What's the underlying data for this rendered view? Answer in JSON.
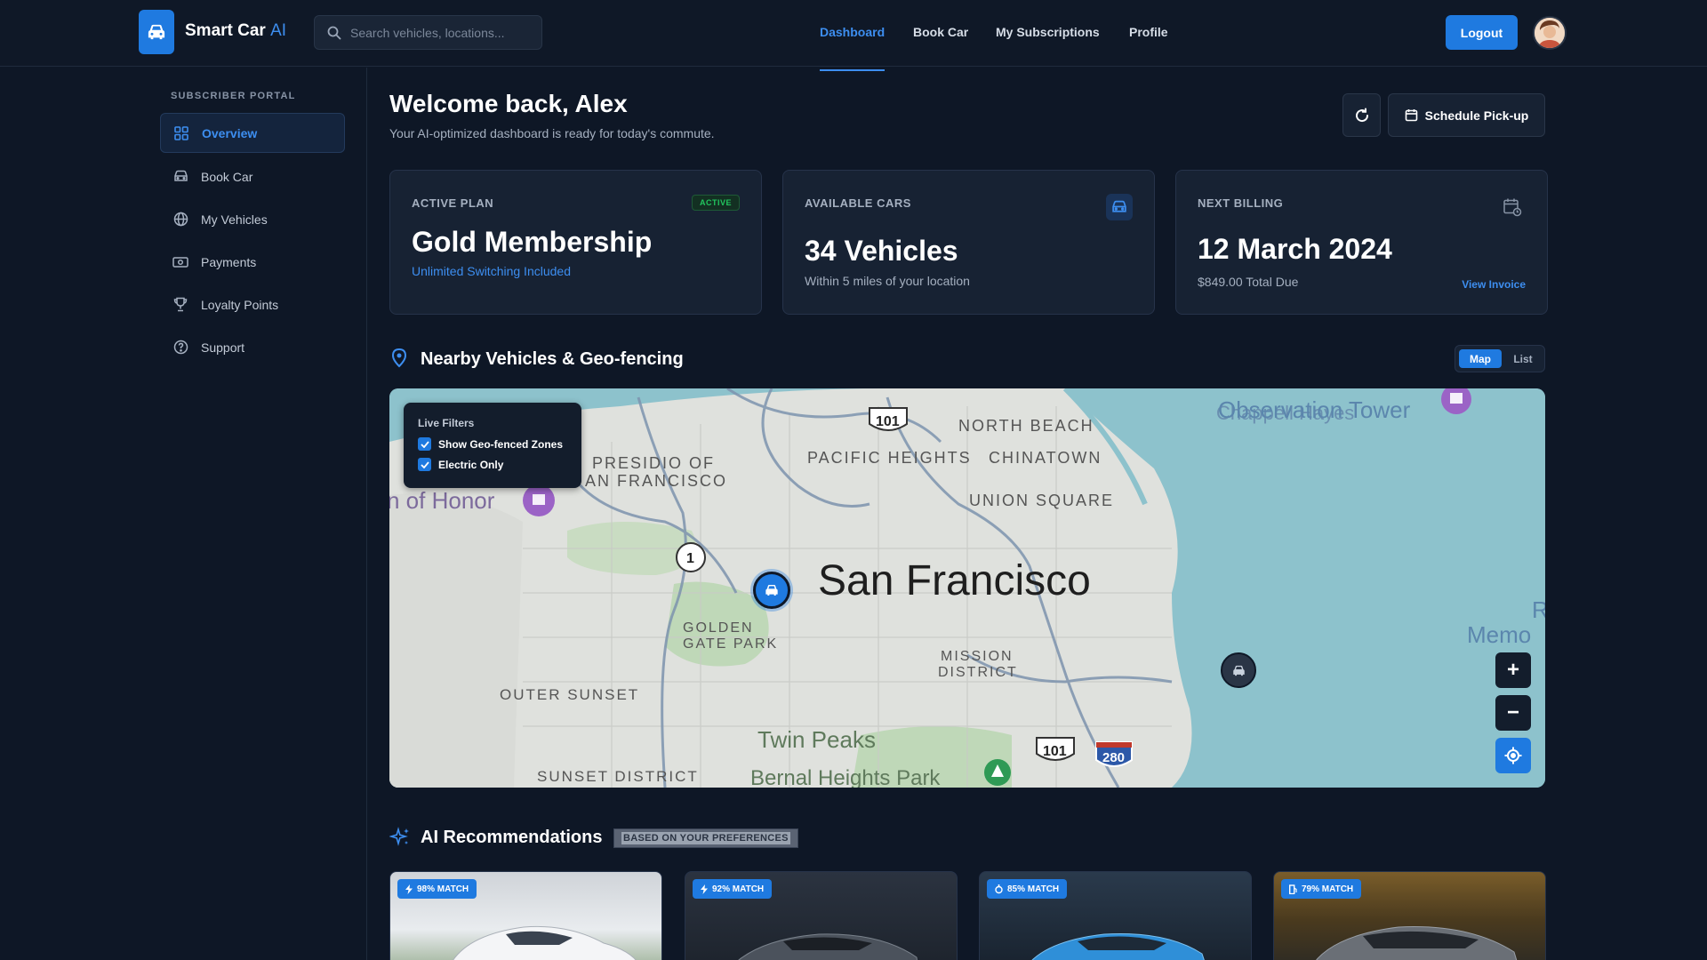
{
  "app": {
    "name": "Smart Car",
    "name_suffix": "AI"
  },
  "search": {
    "placeholder": "Search vehicles, locations..."
  },
  "nav": [
    {
      "label": "Dashboard",
      "active": true
    },
    {
      "label": "Book Car",
      "active": false
    },
    {
      "label": "My Subscriptions",
      "active": false
    },
    {
      "label": "Profile",
      "active": false
    }
  ],
  "header": {
    "logout_label": "Logout"
  },
  "sidebar": {
    "title": "SUBSCRIBER PORTAL",
    "items": [
      {
        "label": "Overview",
        "icon": "grid-icon",
        "active": true
      },
      {
        "label": "Book Car",
        "icon": "car-icon",
        "active": false
      },
      {
        "label": "My Vehicles",
        "icon": "globe-icon",
        "active": false
      },
      {
        "label": "Payments",
        "icon": "cash-icon",
        "active": false
      },
      {
        "label": "Loyalty Points",
        "icon": "trophy-icon",
        "active": false
      },
      {
        "label": "Support",
        "icon": "help-icon",
        "active": false
      }
    ]
  },
  "main": {
    "welcome": "Welcome back, Alex",
    "subtitle": "Your AI-optimized dashboard is ready for today's commute.",
    "schedule_label": "Schedule Pick-up"
  },
  "cards": {
    "plan": {
      "label": "ACTIVE PLAN",
      "badge": "ACTIVE",
      "value": "Gold Membership",
      "sub": "Unlimited Switching Included"
    },
    "cars": {
      "label": "AVAILABLE CARS",
      "value": "34 Vehicles",
      "sub": "Within 5 miles of your location"
    },
    "billing": {
      "label": "NEXT BILLING",
      "value": "12 March 2024",
      "sub": "$849.00 Total Due",
      "link": "View Invoice"
    }
  },
  "nearby": {
    "title": "Nearby Vehicles & Geo-fencing",
    "toggle": {
      "map": "Map",
      "list": "List",
      "selected": "Map"
    }
  },
  "map": {
    "filters_title": "Live Filters",
    "filters": [
      {
        "label": "Show Geo-fenced Zones",
        "checked": true
      },
      {
        "label": "Electric Only",
        "checked": true
      }
    ],
    "labels": {
      "city": "San Francisco",
      "north_beach": "NORTH BEACH",
      "pacific_heights": "PACIFIC HEIGHTS",
      "chinatown": "CHINATOWN",
      "union_square": "UNION SQUARE",
      "presidio_1": "PRESIDIO OF",
      "presidio_2": "AN FRANCISCO",
      "honor": "n of Honor",
      "golden_gate_1": "GOLDEN",
      "golden_gate_2": "GATE PARK",
      "mission_1": "MISSION",
      "mission_2": "DISTRICT",
      "outer_sunset": "OUTER SUNSET",
      "twin_peaks": "Twin Peaks",
      "sunset_district": "SUNSET DISTRICT",
      "bernal": "Bernal Heights Park",
      "observation_1": "Chappell Hayes",
      "observation_2": "Observation Tower",
      "r_label": "R",
      "memo": "Memo",
      "hwy_101_a": "101",
      "hwy_101_b": "101",
      "hwy_1": "1",
      "hwy_280": "280"
    },
    "zoom_in": "+",
    "zoom_out": "−"
  },
  "recommendations": {
    "title": "AI Recommendations",
    "badge": "BASED ON YOUR PREFERENCES",
    "items": [
      {
        "match": "98% MATCH",
        "icon": "bolt-icon"
      },
      {
        "match": "92% MATCH",
        "icon": "bolt-icon"
      },
      {
        "match": "85% MATCH",
        "icon": "gas-icon"
      },
      {
        "match": "79% MATCH",
        "icon": "gas-icon"
      }
    ]
  },
  "colors": {
    "accent": "#1f7ae0",
    "bg": "#0e1726",
    "card": "#172233",
    "success": "#22c55e"
  }
}
